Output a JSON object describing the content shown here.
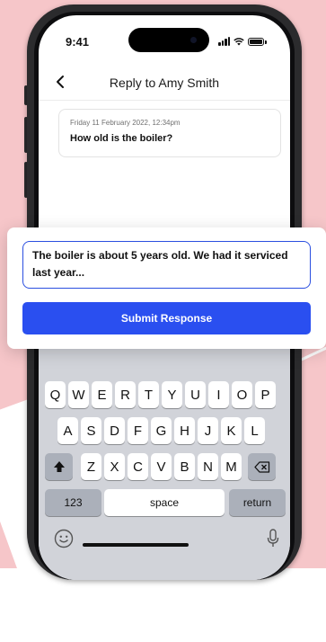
{
  "status_bar": {
    "time": "9:41"
  },
  "nav": {
    "title": "Reply to Amy Smith"
  },
  "message": {
    "date": "Friday 11 February 2022, 12:34pm",
    "text": "How old is the boiler?"
  },
  "response": {
    "text": "The boiler is about 5 years old. We had it serviced last year...",
    "submit_label": "Submit Response"
  },
  "keyboard": {
    "row1": [
      "Q",
      "W",
      "E",
      "R",
      "T",
      "Y",
      "U",
      "I",
      "O",
      "P"
    ],
    "row2": [
      "A",
      "S",
      "D",
      "F",
      "G",
      "H",
      "J",
      "K",
      "L"
    ],
    "row3": [
      "Z",
      "X",
      "C",
      "V",
      "B",
      "N",
      "M"
    ],
    "numbers_label": "123",
    "space_label": "space",
    "return_label": "return"
  },
  "colors": {
    "accent": "#2a4ff0",
    "background": "#f6c6c9"
  }
}
